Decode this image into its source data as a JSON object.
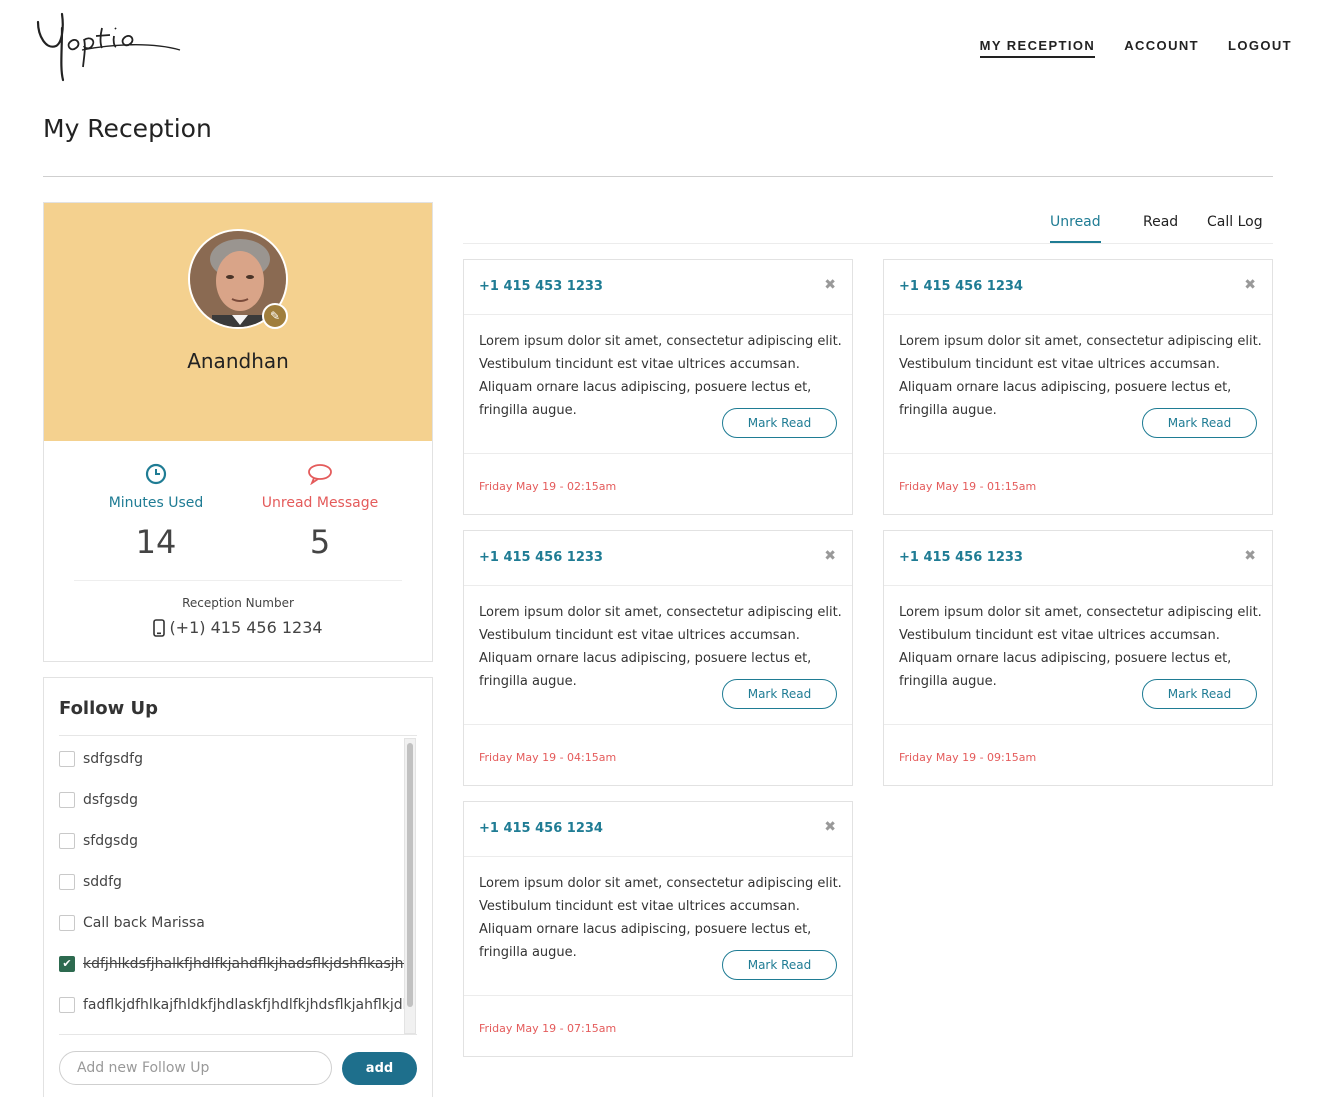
{
  "header": {
    "logo_text": "Yoptio",
    "nav": [
      "MY RECEPTION",
      "ACCOUNT",
      "LOGOUT"
    ]
  },
  "page": {
    "title": "My Reception"
  },
  "profile": {
    "name": "Anandhan",
    "minutes_label": "Minutes Used",
    "minutes_value": "14",
    "unread_label": "Unread Message",
    "unread_value": "5",
    "reception_label": "Reception Number",
    "reception_number": "(+1) 415 456 1234"
  },
  "follow_up": {
    "title": "Follow Up",
    "items": [
      {
        "text": "sdfgsdfg",
        "checked": false
      },
      {
        "text": "dsfgsdg",
        "checked": false
      },
      {
        "text": "sfdgsdg",
        "checked": false
      },
      {
        "text": "sddfg",
        "checked": false
      },
      {
        "text": "Call back Marissa",
        "checked": false
      },
      {
        "text": "kdfjhlkdsfjhalkfjhdlfkjahdflkjhadsflkjdshflkasjhfdsl",
        "checked": true
      },
      {
        "text": "fadflkjdfhlkajfhldkfjhdlaskfjhdlfkjhdsflkjahflkjdhsf",
        "checked": false
      }
    ],
    "input_placeholder": "Add new Follow Up",
    "add_label": "add"
  },
  "tabs": [
    "Unread",
    "Read",
    "Call Log"
  ],
  "messages": [
    {
      "phone": "+1 415 453 1233",
      "body": "Lorem ipsum dolor sit amet, consectetur adipiscing elit. Vestibulum tincidunt est vitae ultrices accumsan. Aliquam ornare lacus adipiscing, posuere lectus et, fringilla augue.",
      "action": "Mark Read",
      "date": "Friday May 19 - 02:15am"
    },
    {
      "phone": "+1 415 456 1234",
      "body": "Lorem ipsum dolor sit amet, consectetur adipiscing elit. Vestibulum tincidunt est vitae ultrices accumsan. Aliquam ornare lacus adipiscing, posuere lectus et, fringilla augue.",
      "action": "Mark Read",
      "date": "Friday May 19 - 01:15am"
    },
    {
      "phone": "+1 415 456 1233",
      "body": "Lorem ipsum dolor sit amet, consectetur adipiscing elit. Vestibulum tincidunt est vitae ultrices accumsan. Aliquam ornare lacus adipiscing, posuere lectus et, fringilla augue.",
      "action": "Mark Read",
      "date": "Friday May 19 - 04:15am"
    },
    {
      "phone": "+1 415 456 1233",
      "body": "Lorem ipsum dolor sit amet, consectetur adipiscing elit. Vestibulum tincidunt est vitae ultrices accumsan. Aliquam ornare lacus adipiscing, posuere lectus et, fringilla augue.",
      "action": "Mark Read",
      "date": "Friday May 19 - 09:15am"
    },
    {
      "phone": "+1 415 456 1234",
      "body": "Lorem ipsum dolor sit amet, consectetur adipiscing elit. Vestibulum tincidunt est vitae ultrices accumsan. Aliquam ornare lacus adipiscing, posuere lectus et, fringilla augue.",
      "action": "Mark Read",
      "date": "Friday May 19 - 07:15am"
    }
  ],
  "colors": {
    "accent": "#1f7c94",
    "alert": "#e45b5b",
    "profile_bg": "#f4d18f",
    "add_button": "#1e6f8c"
  },
  "icons": {
    "minutes": "clock-icon",
    "unread": "speech-bubble-icon",
    "phone": "mobile-phone-icon",
    "close": "close-icon",
    "edit": "edit-icon"
  }
}
